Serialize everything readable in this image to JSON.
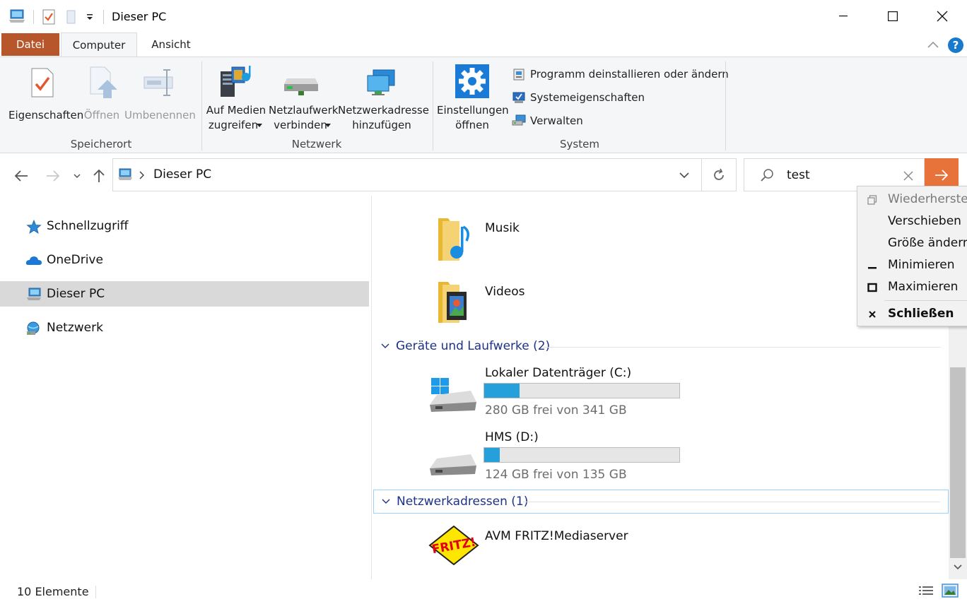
{
  "window": {
    "title": "Dieser PC"
  },
  "ribbon": {
    "tabs": [
      {
        "label": "Datei"
      },
      {
        "label": "Computer"
      },
      {
        "label": "Ansicht"
      }
    ],
    "groups": {
      "speicherort": {
        "label": "Speicherort",
        "commands": [
          {
            "label": "Eigenschaften",
            "enabled": true
          },
          {
            "label": "Öffnen",
            "enabled": false
          },
          {
            "label": "Umbenennen",
            "enabled": false
          }
        ]
      },
      "netzwerk": {
        "label": "Netzwerk",
        "commands": [
          {
            "line1": "Auf Medien",
            "line2": "zugreifen"
          },
          {
            "line1": "Netzlaufwerk",
            "line2": "verbinden"
          },
          {
            "line1": "Netzwerkadresse",
            "line2": "hinzufügen"
          }
        ]
      },
      "system": {
        "label": "System",
        "large": {
          "line1": "Einstellungen",
          "line2": "öffnen"
        },
        "small": [
          {
            "label": "Programm deinstallieren oder ändern"
          },
          {
            "label": "Systemeigenschaften"
          },
          {
            "label": "Verwalten"
          }
        ]
      }
    }
  },
  "address": {
    "path": "Dieser PC"
  },
  "search": {
    "value": "test"
  },
  "nav": [
    {
      "label": "Schnellzugriff",
      "icon": "star-icon"
    },
    {
      "label": "OneDrive",
      "icon": "cloud-icon"
    },
    {
      "label": "Dieser PC",
      "icon": "computer-icon",
      "selected": true
    },
    {
      "label": "Netzwerk",
      "icon": "network-icon"
    }
  ],
  "content": {
    "folders": [
      {
        "name": "Musik"
      },
      {
        "name": "Videos"
      }
    ],
    "drives_group": {
      "label": "Geräte und Laufwerke (2)"
    },
    "drives": [
      {
        "name": "Lokaler Datenträger (C:)",
        "free_text": "280 GB frei von 341 GB",
        "used_fraction": 0.18
      },
      {
        "name": "HMS (D:)",
        "free_text": "124 GB frei von 135 GB",
        "used_fraction": 0.08
      }
    ],
    "network_group": {
      "label": "Netzwerkadressen (1)"
    },
    "network_items": [
      {
        "name": "AVM FRITZ!Mediaserver",
        "logo_text": "FRITZ!"
      }
    ]
  },
  "status": {
    "count": "10 Elemente"
  },
  "system_menu": {
    "items": [
      {
        "label": "Wiederherstellen",
        "enabled": false
      },
      {
        "label": "Verschieben",
        "enabled": true
      },
      {
        "label": "Größe ändern",
        "enabled": true
      },
      {
        "label": "Minimieren",
        "enabled": true
      },
      {
        "label": "Maximieren",
        "enabled": true
      },
      {
        "label": "Schließen",
        "enabled": true,
        "bold": true
      }
    ]
  },
  "colors": {
    "file_tab": "#b7552b",
    "search_go": "#e8733a",
    "drive_bar": "#26a0da",
    "group_heading": "#1e3287"
  }
}
